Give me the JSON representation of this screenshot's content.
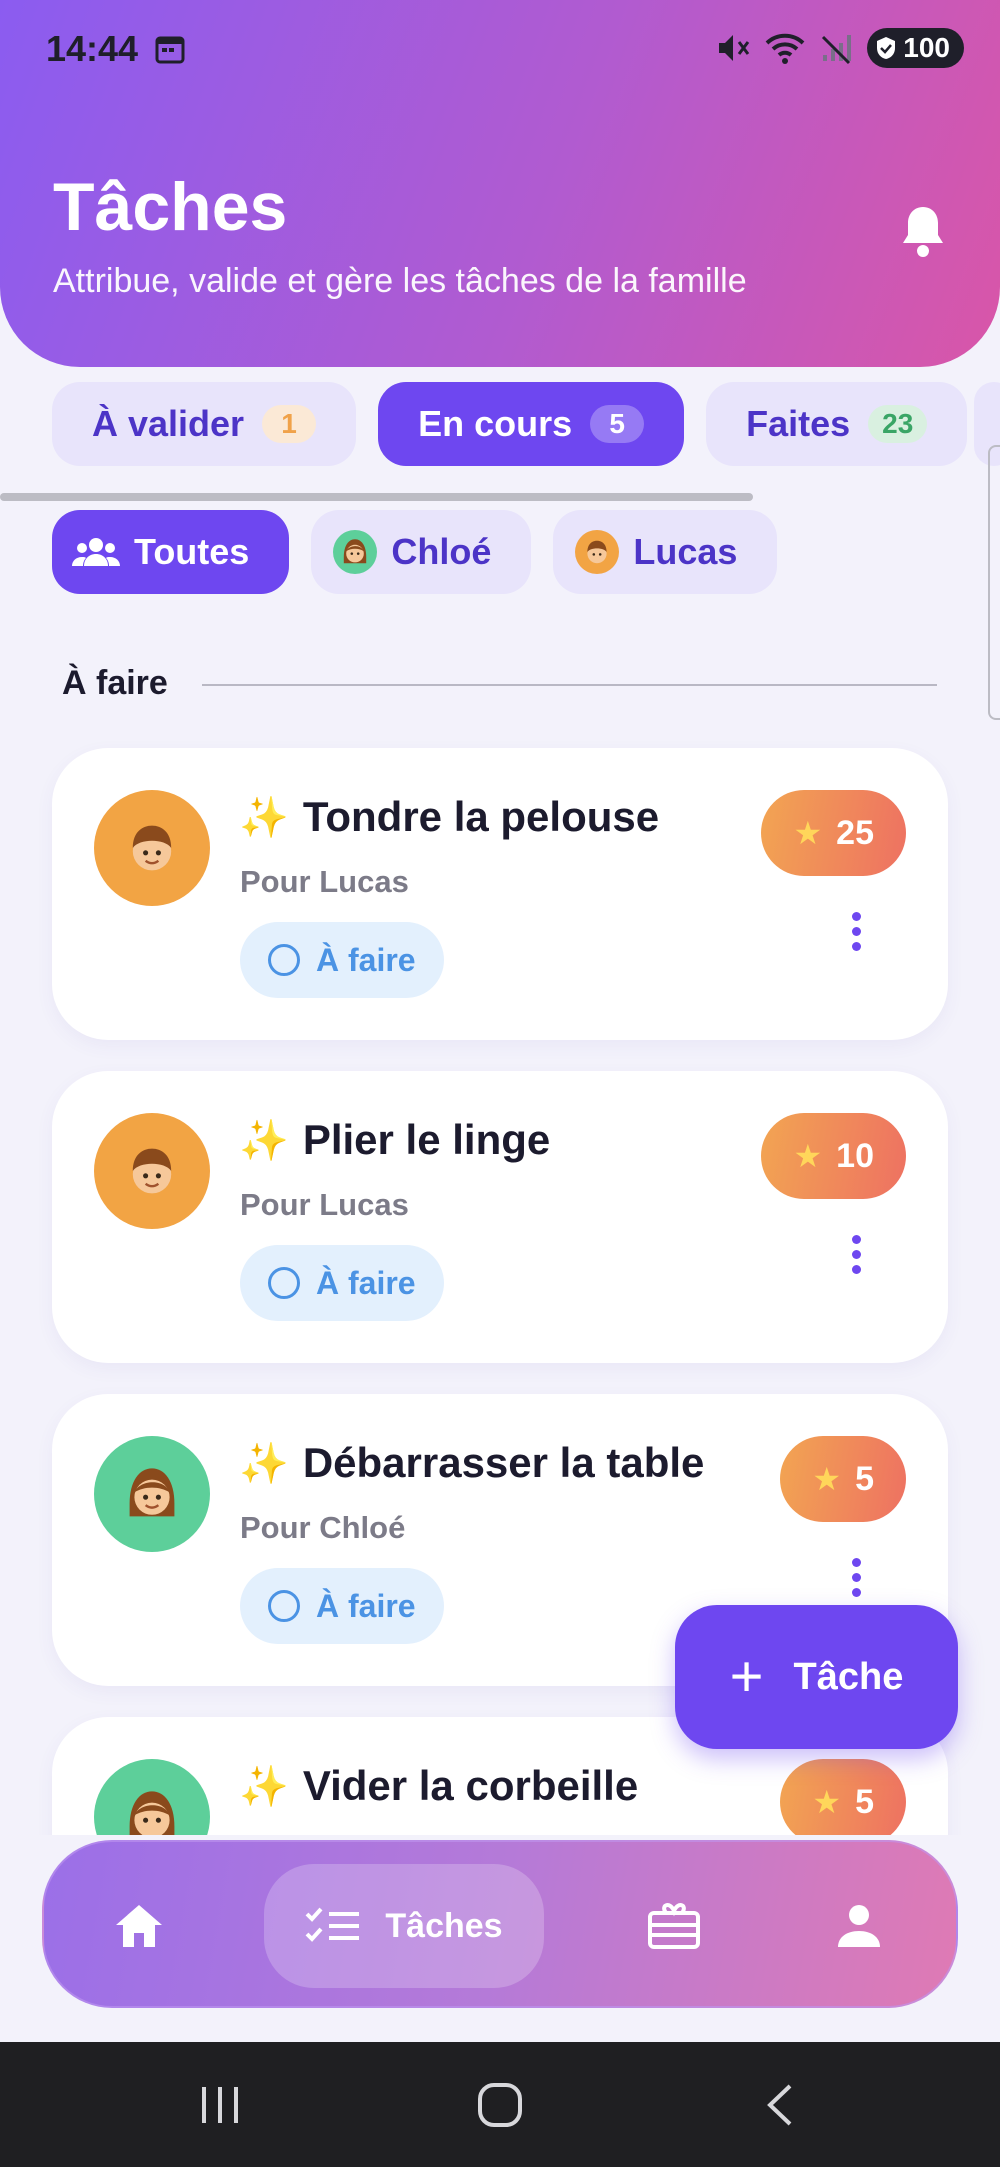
{
  "status_bar": {
    "time": "14:44",
    "battery": "100"
  },
  "header": {
    "title": "Tâches",
    "subtitle": "Attribue, valide et gère les tâches de la famille"
  },
  "tabs": [
    {
      "label": "À valider",
      "count": "1"
    },
    {
      "label": "En cours",
      "count": "5"
    },
    {
      "label": "Faites",
      "count": "23"
    }
  ],
  "filters": [
    {
      "label": "Toutes"
    },
    {
      "label": "Chloé"
    },
    {
      "label": "Lucas"
    }
  ],
  "section": {
    "title": "À faire"
  },
  "tasks": [
    {
      "title": "Tondre la pelouse",
      "for": "Pour Lucas",
      "status": "À faire",
      "points": "25"
    },
    {
      "title": "Plier le linge",
      "for": "Pour Lucas",
      "status": "À faire",
      "points": "10"
    },
    {
      "title": "Débarrasser la table",
      "for": "Pour Chloé",
      "status": "À faire",
      "points": "5"
    },
    {
      "title": "Vider la corbeille",
      "points": "5"
    }
  ],
  "fab": {
    "label": "Tâche"
  },
  "bottom_nav": {
    "active_label": "Tâches"
  },
  "colors": {
    "accent": "#6e47f0",
    "header_start": "#8b5cf0",
    "header_end": "#d956a8",
    "status_blue": "#4b93e4"
  }
}
